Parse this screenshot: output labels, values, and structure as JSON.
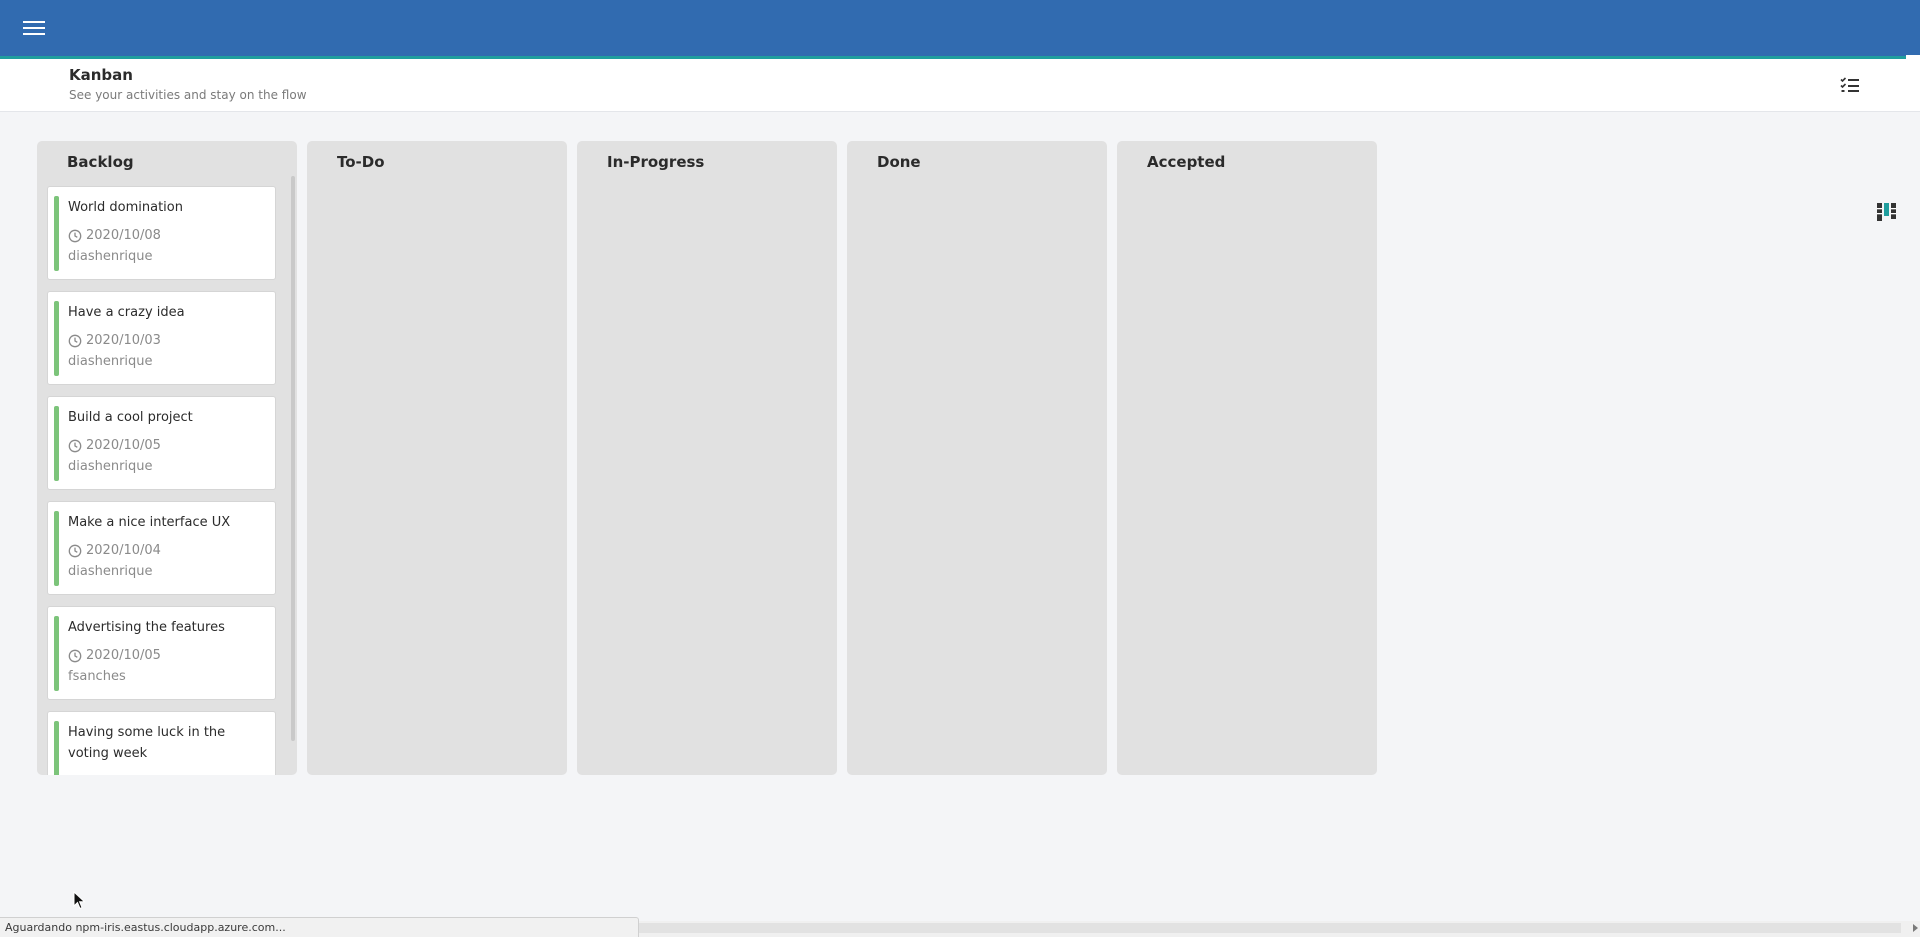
{
  "colors": {
    "topbar": "#316bb0",
    "topbar_accent": "#1f9e9e",
    "column_bg": "#e1e1e1",
    "card_accent": "#7cc47a",
    "page_bg": "#f4f5f7"
  },
  "topbar": {
    "menu_icon": "hamburger-menu-icon"
  },
  "header": {
    "title": "Kanban",
    "subtitle": "See your activities and stay on the flow",
    "icons": [
      "checklist-icon",
      "kanban-board-icon"
    ]
  },
  "columns": [
    {
      "title": "Backlog",
      "cards": [
        {
          "title": "World domination",
          "date": "2020/10/08",
          "user": "diashenrique"
        },
        {
          "title": "Have a crazy idea",
          "date": "2020/10/03",
          "user": "diashenrique"
        },
        {
          "title": "Build a cool project",
          "date": "2020/10/05",
          "user": "diashenrique"
        },
        {
          "title": "Make a nice interface UX",
          "date": "2020/10/04",
          "user": "diashenrique"
        },
        {
          "title": "Advertising the features",
          "date": "2020/10/05",
          "user": "fsanches"
        },
        {
          "title": "Having some luck in the voting week",
          "date": "",
          "user": ""
        }
      ]
    },
    {
      "title": "To-Do",
      "cards": []
    },
    {
      "title": "In-Progress",
      "cards": []
    },
    {
      "title": "Done",
      "cards": []
    },
    {
      "title": "Accepted",
      "cards": []
    }
  ],
  "status_bar": {
    "text": "Aguardando npm-iris.eastus.cloudapp.azure.com..."
  }
}
